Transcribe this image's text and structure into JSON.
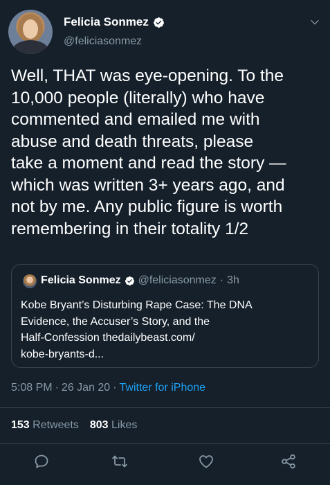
{
  "author": {
    "display_name": "Felicia Sonmez",
    "handle": "@feliciasonmez"
  },
  "tweet": {
    "text": "Well, THAT was eye-opening. To the\n10,000 people (literally) who have\ncommented and emailed me with\nabuse and death threats, please\ntake a moment and read the story —\nwhich was written 3+ years ago, and\nnot by me. Any public figure is worth\nremembering in their totality 1/2"
  },
  "quoted": {
    "display_name": "Felicia Sonmez",
    "handle": "@feliciasonmez",
    "separator": "·",
    "time": "3h",
    "text": "Kobe Bryant’s Disturbing Rape Case: The DNA\nEvidence, the Accuser’s Story, and the\nHalf-Confession thedailybeast.com/\nkobe-bryants-d..."
  },
  "meta": {
    "time": "5:08 PM",
    "sep1": "·",
    "date": "26 Jan 20",
    "sep2": "·",
    "source": "Twitter for iPhone"
  },
  "stats": {
    "retweets_count": "153",
    "retweets_label": "Retweets",
    "likes_count": "803",
    "likes_label": "Likes"
  },
  "icons": {
    "verified": "verified-badge-icon",
    "menu": "chevron-down-icon",
    "reply": "reply-icon",
    "retweet": "retweet-icon",
    "like": "heart-icon",
    "share": "share-icon"
  },
  "colors": {
    "background": "#15202b",
    "secondary_text": "#8899a6",
    "link": "#1da1f2",
    "border": "#38444d"
  }
}
